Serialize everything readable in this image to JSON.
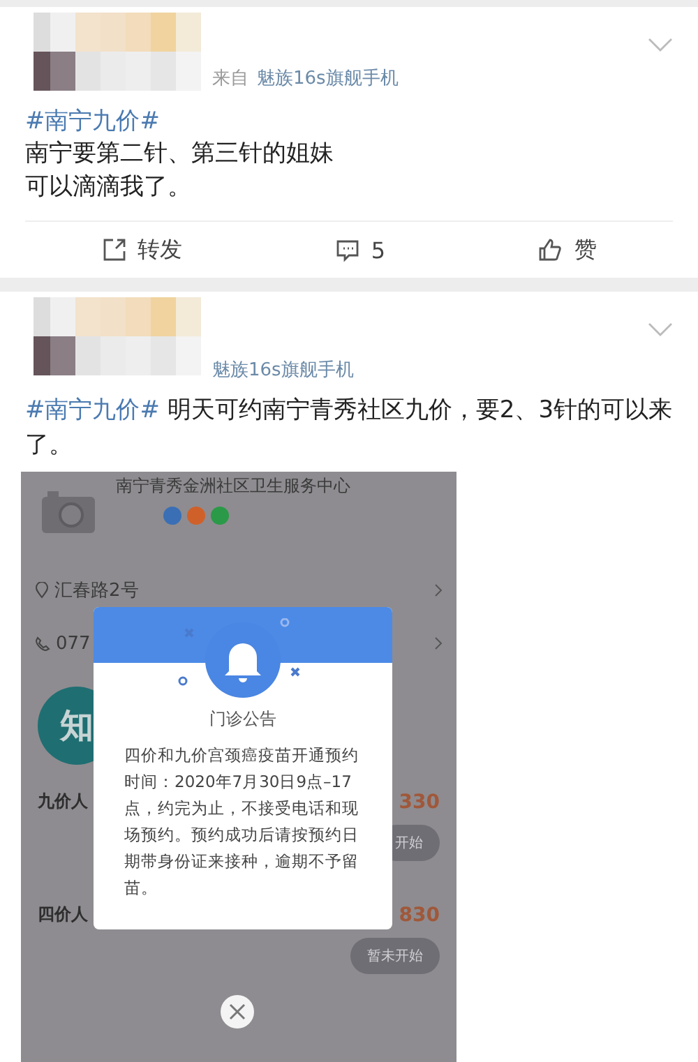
{
  "posts": [
    {
      "source_label": "来自",
      "source": "魅族16s旗舰手机",
      "hashtag": "#南宁九价#",
      "body_lines": [
        "南宁要第二针、第三针的姐妹",
        "可以滴滴我了。"
      ],
      "actions": [
        {
          "kind": "repost",
          "label": "转发"
        },
        {
          "kind": "comment",
          "label": "5"
        },
        {
          "kind": "like",
          "label": "赞"
        }
      ]
    },
    {
      "source": "魅族16s旗舰手机",
      "hashtag": "#南宁九价#",
      "text": " 明天可约南宁青秀社区九价，要2、3针的可以来了。",
      "attachment": {
        "center_name": "南宁青秀金洲社区卫生服务中心",
        "pay_methods": [
          {
            "color": "#3a6fb5"
          },
          {
            "color": "#d0602a"
          },
          {
            "color": "#2a9a48"
          }
        ],
        "address": "汇春路2号",
        "phone": "077",
        "badge": "知",
        "vaccines": [
          {
            "name": "九价人",
            "price": "330",
            "button": "开始"
          },
          {
            "name": "四价人",
            "price": "830",
            "button": "暂未开始"
          }
        ],
        "notice": {
          "title": "门诊公告",
          "body": "四价和九价宫颈癌疫苗开通预约时间：2020年7月30日9点–17点，约完为止，不接受电话和现场预约。预约成功后请按预约日期带身份证来接种，逾期不予留苗。"
        }
      }
    }
  ]
}
